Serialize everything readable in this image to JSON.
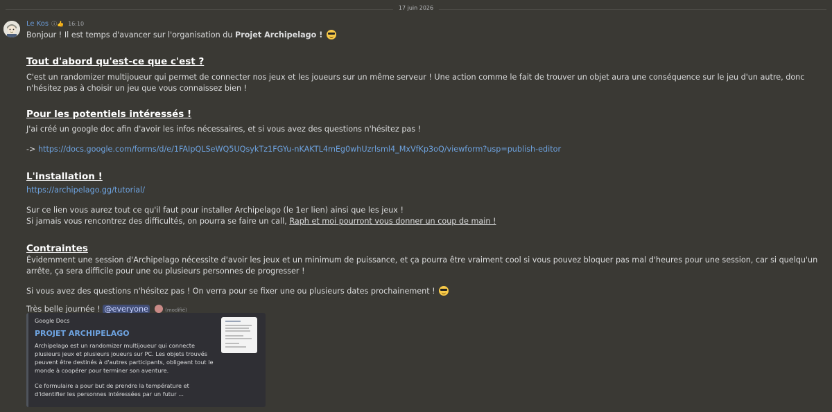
{
  "date_divider": "17 juin 2026",
  "message": {
    "author": "Le Kos",
    "badges": "ⓘ👍",
    "timestamp": "16:10",
    "greeting": "Bonjour ! Il est temps d'avancer sur l'organisation du ",
    "greeting_bold": "Projet Archipelago !",
    "s1_title": "Tout d'abord qu'est-ce que c'est ?",
    "s1_text": "C'est un randomizer multijoueur qui permet de connecter nos jeux et les joueurs sur un même serveur ! Une action comme le fait de trouver un objet aura une conséquence sur le jeu d'un autre, donc n'hésitez pas à choisir un jeu que vous connaissez bien !",
    "s2_title": "Pour les potentiels intéressés !",
    "s2_text": "J'ai créé un google doc afin d'avoir les infos nécessaires, et si vous avez des questions n'hésitez pas !",
    "s2_arrow": "-> ",
    "s2_link": "https://docs.google.com/forms/d/e/1FAIpQLSeWQ5UQsykTz1FGYu-nKAKTL4mEg0whUzrlsml4_MxVfKp3oQ/viewform?usp=publish-editor",
    "s3_title": "L'installation !",
    "s3_link": "https://archipelago.gg/tutorial/",
    "s3_text1": "Sur ce lien vous aurez tout ce qu'il faut pour installer Archipelago (le 1er lien) ainsi que les jeux !",
    "s3_text2": "Si jamais vous rencontrez des difficultés, on pourra se faire un call, ",
    "s3_text2_underlined": "Raph et moi pourront vous donner un coup de main !",
    "s4_title": "Contraintes",
    "s4_text": "Évidemment une session d'Archipelago nécessite d'avoir les jeux et un minimum de puissance, et ça pourra être vraiment cool si vous pouvez bloquer pas mal d'heures pour une session, car si quelqu'un arrête, ça sera difficile pour une ou plusieurs personnes de progresser !",
    "s4_text2": "Si vous avez des questions n'hésitez pas ! On verra pour se fixer une ou plusieurs dates prochainement !",
    "closing": "Très belle journée ! ",
    "mention": "@everyone",
    "edited": "(modifié)"
  },
  "embed": {
    "provider": "Google Docs",
    "title": "PROJET ARCHIPELAGO",
    "desc1": "Archipelago est un randomizer multijoueur qui connecte plusieurs jeux et plusieurs joueurs sur PC. Les objets trouvés peuvent être destinés à d'autres participants, obligeant tout le monde à coopérer pour terminer son aventure.",
    "desc2": "Ce formulaire a pour but de prendre la température et d'identifier les personnes intéressées par un futur ..."
  }
}
